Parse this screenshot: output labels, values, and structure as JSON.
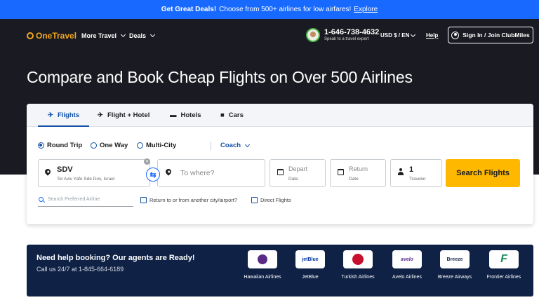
{
  "promo": {
    "bold": "Get Great Deals!",
    "text": "Choose from 500+ airlines for low airfares!",
    "link": "Explore"
  },
  "header": {
    "logo": "OneTravel",
    "nav": [
      {
        "label": "More Travel"
      },
      {
        "label": "Deals"
      }
    ],
    "phone": "1-646-738-4632",
    "phone_sub": "Speak to a travel expert",
    "currency": "USD $ / EN",
    "help": "Help",
    "signin": "Sign In / Join ClubMiles"
  },
  "headline": "Compare and Book Cheap Flights on Over 500 Airlines",
  "tabs": [
    {
      "label": "Flights",
      "icon": "plane-icon"
    },
    {
      "label": "Flight + Hotel",
      "icon": "plane-hotel-icon"
    },
    {
      "label": "Hotels",
      "icon": "bed-icon"
    },
    {
      "label": "Cars",
      "icon": "car-icon"
    }
  ],
  "trip_types": [
    {
      "label": "Round Trip",
      "selected": true
    },
    {
      "label": "One Way",
      "selected": false
    },
    {
      "label": "Multi-City",
      "selected": false
    }
  ],
  "cabin": "Coach",
  "search": {
    "from_code": "SDV",
    "from_name": "Tel Aviv Yafo Sde Dov, Israel",
    "to_placeholder": "To where?",
    "depart_label": "Depart",
    "depart_sub": "Date",
    "return_label": "Return",
    "return_sub": "Date",
    "travelers_count": "1",
    "travelers_label": "Traveler",
    "button": "Search Flights",
    "airline_placeholder": "Search Preferred Airline",
    "opt_nearby": "Return to or from another city/airport?",
    "opt_direct": "Direct Flights"
  },
  "help_banner": {
    "title": "Need help booking? Our agents are Ready!",
    "sub": "Call us 24/7 at 1-845-664-6189",
    "airlines": [
      {
        "name": "Hawaiian Airlines",
        "logo_text": "",
        "color": "#5b2a86"
      },
      {
        "name": "JetBlue",
        "logo_text": "jetBlue",
        "color": "#0033a0"
      },
      {
        "name": "Turkish Airlines",
        "logo_text": "",
        "color": "#c8102e"
      },
      {
        "name": "Avelo Airlines",
        "logo_text": "avelo",
        "color": "#5b2d90"
      },
      {
        "name": "Breeze Airways",
        "logo_text": "Breeze",
        "color": "#1b2a4a"
      },
      {
        "name": "Frontier Airlines",
        "logo_text": "F",
        "color": "#1a8a5a"
      }
    ]
  },
  "colors": {
    "promo": "#1769ff",
    "hero": "#1a1a22",
    "accent": "#1250a8",
    "cta": "#ffb800",
    "banner": "#0f2145"
  }
}
